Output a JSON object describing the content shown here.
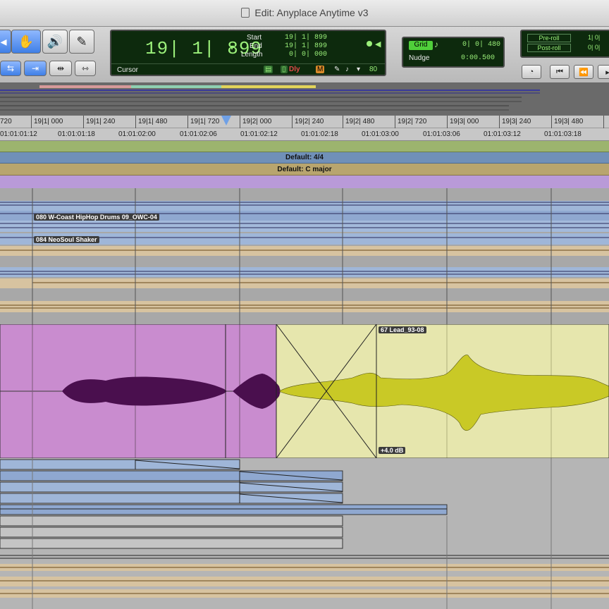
{
  "window": {
    "title": "Edit: Anyplace Anytime v3"
  },
  "counter": {
    "main": "19| 1| 899",
    "cursor_label": "Cursor",
    "start_label": "Start",
    "end_label": "End",
    "length_label": "Length",
    "start": "19| 1| 899",
    "end": "19| 1| 899",
    "length": "0| 0| 000",
    "dly": "Dly",
    "tempo": "80"
  },
  "grid": {
    "grid_label": "Grid",
    "grid_value": "0| 0| 480",
    "nudge_label": "Nudge",
    "nudge_value": "0:00.500"
  },
  "preroll": {
    "pre_label": "Pre-roll",
    "post_label": "Post-roll",
    "pre_value": "1| 0|",
    "post_value": "0| 0|"
  },
  "ruler": {
    "bars": [
      "720",
      "19|1| 000",
      "19|1| 240",
      "19|1| 480",
      "19|1| 720",
      "19|2| 000",
      "19|2| 240",
      "19|2| 480",
      "19|2| 720",
      "19|3| 000",
      "19|3| 240",
      "19|3| 480"
    ],
    "timecode": [
      "01:01:01:12",
      "01:01:01:18",
      "01:01:02:00",
      "01:01:02:06",
      "01:01:02:12",
      "01:01:02:18",
      "01:01:03:00",
      "01:01:03:06",
      "01:01:03:12",
      "01:01:03:18"
    ]
  },
  "meter": {
    "label": "Default: 4/4"
  },
  "key": {
    "label": "Default: C major"
  },
  "clips": {
    "drums": "080 W-Coast HipHop Drums 09_OWC-04",
    "shaker": "084 NeoSoul Shaker",
    "lead": "67 Lead_93-08",
    "gain": "+4.0 dB"
  },
  "colors": {
    "counter_green": "#9bf07a",
    "lead_left": "#c98ccf",
    "lead_right": "#e6e6ad",
    "wave_left": "#4a0f4e",
    "wave_right": "#c9c926",
    "meter_band": "#7090b8",
    "key_band": "#b8a56e"
  }
}
